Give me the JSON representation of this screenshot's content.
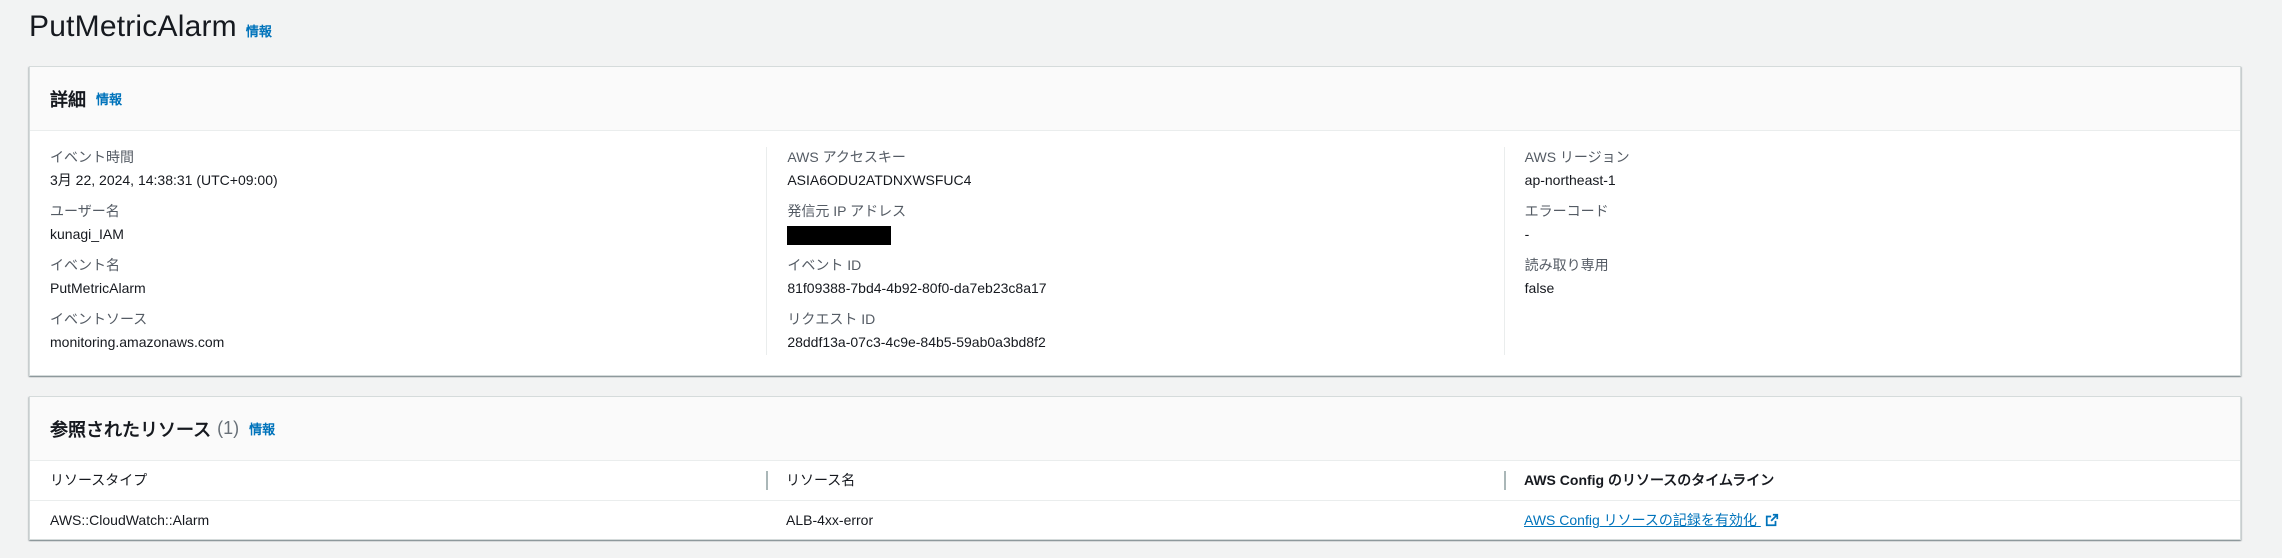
{
  "page": {
    "title": "PutMetricAlarm",
    "info_label": "情報"
  },
  "details": {
    "title": "詳細",
    "info_label": "情報",
    "columns": [
      [
        {
          "key": "イベント時間",
          "value": "3月 22, 2024, 14:38:31 (UTC+09:00)"
        },
        {
          "key": "ユーザー名",
          "value": "kunagi_IAM"
        },
        {
          "key": "イベント名",
          "value": "PutMetricAlarm"
        },
        {
          "key": "イベントソース",
          "value": "monitoring.amazonaws.com"
        }
      ],
      [
        {
          "key": "AWS アクセスキー",
          "value": "ASIA6ODU2ATDNXWSFUC4"
        },
        {
          "key": "発信元 IP アドレス",
          "value": ""
        },
        {
          "key": "イベント ID",
          "value": "81f09388-7bd4-4b92-80f0-da7eb23c8a17"
        },
        {
          "key": "リクエスト ID",
          "value": "28ddf13a-07c3-4c9e-84b5-59ab0a3bd8f2"
        }
      ],
      [
        {
          "key": "AWS リージョン",
          "value": "ap-northeast-1"
        },
        {
          "key": "エラーコード",
          "value": "-"
        },
        {
          "key": "読み取り専用",
          "value": "false"
        }
      ]
    ]
  },
  "resources": {
    "title": "参照されたリソース",
    "count": "(1)",
    "info_label": "情報",
    "headers": [
      "リソースタイプ",
      "リソース名",
      "AWS Config のリソースのタイムライン"
    ],
    "rows": [
      {
        "type": "AWS::CloudWatch::Alarm",
        "name": "ALB-4xx-error",
        "timeline_link": "AWS Config リソースの記録を有効化"
      }
    ]
  },
  "icons": {
    "external_link": "external-link-icon"
  },
  "colors": {
    "link": "#0073bb",
    "background": "#f2f3f3",
    "card": "#ffffff"
  }
}
